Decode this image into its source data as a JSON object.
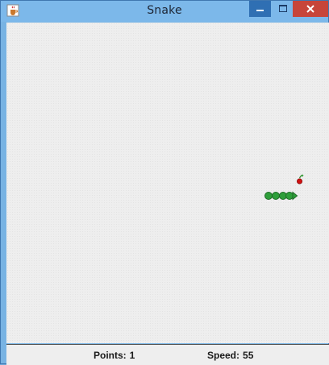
{
  "window": {
    "title": "Snake"
  },
  "status": {
    "points_label": "Points:",
    "points": "1",
    "speed_label": "Speed:",
    "speed": "55"
  },
  "game": {
    "snake_color": "#2e9e3a",
    "snake_outline": "#1f6b27",
    "food": "cherry",
    "food_color": "#d01010"
  },
  "icons": {
    "app": "java-coffee-icon",
    "minimize": "minimize-icon",
    "maximize": "maximize-icon",
    "close": "close-icon"
  }
}
